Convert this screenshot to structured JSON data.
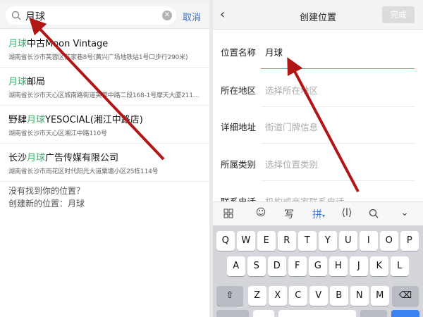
{
  "left": {
    "search": {
      "query": "月球",
      "cancel_label": "取消"
    },
    "results": [
      {
        "pre": "",
        "hl": "月球",
        "post": "中古Moon Vintage",
        "addr": "湖南省长沙市芙蓉区苏家巷8号(黄兴广场地铁站1号口步行290米)"
      },
      {
        "pre": "",
        "hl": "月球",
        "post": "邮局",
        "addr": "湖南省长沙市天心区城南路街道芙蓉中路二段168-1号摩天大厦211…"
      },
      {
        "pre": "野肆",
        "hl": "月球",
        "post": "YESOCIAL(湘江中路店)",
        "addr": "湖南省长沙市天心区湘江中路110号"
      },
      {
        "pre": "长沙",
        "hl": "月球",
        "post": "广告传媒有限公司",
        "addr": "湖南省长沙市雨花区时代阳光大道粟塘小区25栋114号"
      }
    ],
    "not_found": "没有找到你的位置？",
    "create_new": "创建新的位置：月球"
  },
  "right": {
    "title": "创建位置",
    "done_label": "完成",
    "form": {
      "name_label": "位置名称",
      "name_value": "月球",
      "region_label": "所在地区",
      "region_placeholder": "选择所在地区",
      "address_label": "详细地址",
      "address_placeholder": "街道门牌信息",
      "category_label": "所属类别",
      "category_placeholder": "选择位置类别",
      "contact_label": "联系电话",
      "contact_placeholder": "机构或商家联系电话"
    },
    "keyboard": {
      "toolbar": {
        "handwrite": "写",
        "pinyin": "拼",
        "cursor": "⟨I⟩"
      },
      "row1": [
        "Q",
        "W",
        "E",
        "R",
        "T",
        "Y",
        "U",
        "I",
        "O",
        "P"
      ],
      "row2": [
        "A",
        "S",
        "D",
        "F",
        "G",
        "H",
        "J",
        "K",
        "L"
      ],
      "row3": [
        "Z",
        "X",
        "C",
        "V",
        "B",
        "N",
        "M"
      ]
    }
  },
  "colors": {
    "highlight": "#32b36a",
    "accent": "#3a74c4",
    "arrow": "#b01616",
    "active_line": "#35c07a"
  }
}
